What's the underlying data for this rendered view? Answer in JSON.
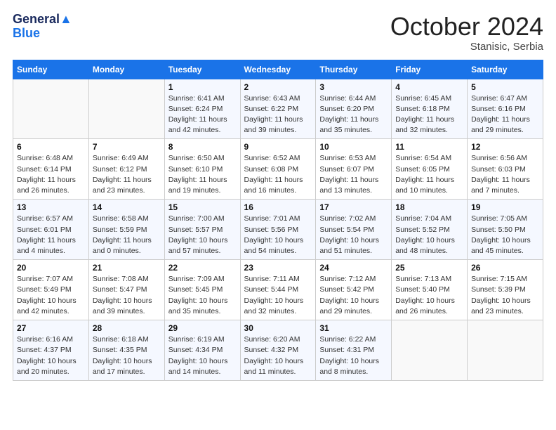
{
  "header": {
    "logo_general": "General",
    "logo_blue": "Blue",
    "month_title": "October 2024",
    "location": "Stanisic, Serbia"
  },
  "days_of_week": [
    "Sunday",
    "Monday",
    "Tuesday",
    "Wednesday",
    "Thursday",
    "Friday",
    "Saturday"
  ],
  "weeks": [
    [
      {
        "day": "",
        "sunrise": "",
        "sunset": "",
        "daylight": "",
        "empty": true
      },
      {
        "day": "",
        "sunrise": "",
        "sunset": "",
        "daylight": "",
        "empty": true
      },
      {
        "day": "1",
        "sunrise": "Sunrise: 6:41 AM",
        "sunset": "Sunset: 6:24 PM",
        "daylight": "Daylight: 11 hours and 42 minutes."
      },
      {
        "day": "2",
        "sunrise": "Sunrise: 6:43 AM",
        "sunset": "Sunset: 6:22 PM",
        "daylight": "Daylight: 11 hours and 39 minutes."
      },
      {
        "day": "3",
        "sunrise": "Sunrise: 6:44 AM",
        "sunset": "Sunset: 6:20 PM",
        "daylight": "Daylight: 11 hours and 35 minutes."
      },
      {
        "day": "4",
        "sunrise": "Sunrise: 6:45 AM",
        "sunset": "Sunset: 6:18 PM",
        "daylight": "Daylight: 11 hours and 32 minutes."
      },
      {
        "day": "5",
        "sunrise": "Sunrise: 6:47 AM",
        "sunset": "Sunset: 6:16 PM",
        "daylight": "Daylight: 11 hours and 29 minutes."
      }
    ],
    [
      {
        "day": "6",
        "sunrise": "Sunrise: 6:48 AM",
        "sunset": "Sunset: 6:14 PM",
        "daylight": "Daylight: 11 hours and 26 minutes."
      },
      {
        "day": "7",
        "sunrise": "Sunrise: 6:49 AM",
        "sunset": "Sunset: 6:12 PM",
        "daylight": "Daylight: 11 hours and 23 minutes."
      },
      {
        "day": "8",
        "sunrise": "Sunrise: 6:50 AM",
        "sunset": "Sunset: 6:10 PM",
        "daylight": "Daylight: 11 hours and 19 minutes."
      },
      {
        "day": "9",
        "sunrise": "Sunrise: 6:52 AM",
        "sunset": "Sunset: 6:08 PM",
        "daylight": "Daylight: 11 hours and 16 minutes."
      },
      {
        "day": "10",
        "sunrise": "Sunrise: 6:53 AM",
        "sunset": "Sunset: 6:07 PM",
        "daylight": "Daylight: 11 hours and 13 minutes."
      },
      {
        "day": "11",
        "sunrise": "Sunrise: 6:54 AM",
        "sunset": "Sunset: 6:05 PM",
        "daylight": "Daylight: 11 hours and 10 minutes."
      },
      {
        "day": "12",
        "sunrise": "Sunrise: 6:56 AM",
        "sunset": "Sunset: 6:03 PM",
        "daylight": "Daylight: 11 hours and 7 minutes."
      }
    ],
    [
      {
        "day": "13",
        "sunrise": "Sunrise: 6:57 AM",
        "sunset": "Sunset: 6:01 PM",
        "daylight": "Daylight: 11 hours and 4 minutes."
      },
      {
        "day": "14",
        "sunrise": "Sunrise: 6:58 AM",
        "sunset": "Sunset: 5:59 PM",
        "daylight": "Daylight: 11 hours and 0 minutes."
      },
      {
        "day": "15",
        "sunrise": "Sunrise: 7:00 AM",
        "sunset": "Sunset: 5:57 PM",
        "daylight": "Daylight: 10 hours and 57 minutes."
      },
      {
        "day": "16",
        "sunrise": "Sunrise: 7:01 AM",
        "sunset": "Sunset: 5:56 PM",
        "daylight": "Daylight: 10 hours and 54 minutes."
      },
      {
        "day": "17",
        "sunrise": "Sunrise: 7:02 AM",
        "sunset": "Sunset: 5:54 PM",
        "daylight": "Daylight: 10 hours and 51 minutes."
      },
      {
        "day": "18",
        "sunrise": "Sunrise: 7:04 AM",
        "sunset": "Sunset: 5:52 PM",
        "daylight": "Daylight: 10 hours and 48 minutes."
      },
      {
        "day": "19",
        "sunrise": "Sunrise: 7:05 AM",
        "sunset": "Sunset: 5:50 PM",
        "daylight": "Daylight: 10 hours and 45 minutes."
      }
    ],
    [
      {
        "day": "20",
        "sunrise": "Sunrise: 7:07 AM",
        "sunset": "Sunset: 5:49 PM",
        "daylight": "Daylight: 10 hours and 42 minutes."
      },
      {
        "day": "21",
        "sunrise": "Sunrise: 7:08 AM",
        "sunset": "Sunset: 5:47 PM",
        "daylight": "Daylight: 10 hours and 39 minutes."
      },
      {
        "day": "22",
        "sunrise": "Sunrise: 7:09 AM",
        "sunset": "Sunset: 5:45 PM",
        "daylight": "Daylight: 10 hours and 35 minutes."
      },
      {
        "day": "23",
        "sunrise": "Sunrise: 7:11 AM",
        "sunset": "Sunset: 5:44 PM",
        "daylight": "Daylight: 10 hours and 32 minutes."
      },
      {
        "day": "24",
        "sunrise": "Sunrise: 7:12 AM",
        "sunset": "Sunset: 5:42 PM",
        "daylight": "Daylight: 10 hours and 29 minutes."
      },
      {
        "day": "25",
        "sunrise": "Sunrise: 7:13 AM",
        "sunset": "Sunset: 5:40 PM",
        "daylight": "Daylight: 10 hours and 26 minutes."
      },
      {
        "day": "26",
        "sunrise": "Sunrise: 7:15 AM",
        "sunset": "Sunset: 5:39 PM",
        "daylight": "Daylight: 10 hours and 23 minutes."
      }
    ],
    [
      {
        "day": "27",
        "sunrise": "Sunrise: 6:16 AM",
        "sunset": "Sunset: 4:37 PM",
        "daylight": "Daylight: 10 hours and 20 minutes."
      },
      {
        "day": "28",
        "sunrise": "Sunrise: 6:18 AM",
        "sunset": "Sunset: 4:35 PM",
        "daylight": "Daylight: 10 hours and 17 minutes."
      },
      {
        "day": "29",
        "sunrise": "Sunrise: 6:19 AM",
        "sunset": "Sunset: 4:34 PM",
        "daylight": "Daylight: 10 hours and 14 minutes."
      },
      {
        "day": "30",
        "sunrise": "Sunrise: 6:20 AM",
        "sunset": "Sunset: 4:32 PM",
        "daylight": "Daylight: 10 hours and 11 minutes."
      },
      {
        "day": "31",
        "sunrise": "Sunrise: 6:22 AM",
        "sunset": "Sunset: 4:31 PM",
        "daylight": "Daylight: 10 hours and 8 minutes."
      },
      {
        "day": "",
        "sunrise": "",
        "sunset": "",
        "daylight": "",
        "empty": true
      },
      {
        "day": "",
        "sunrise": "",
        "sunset": "",
        "daylight": "",
        "empty": true
      }
    ]
  ]
}
